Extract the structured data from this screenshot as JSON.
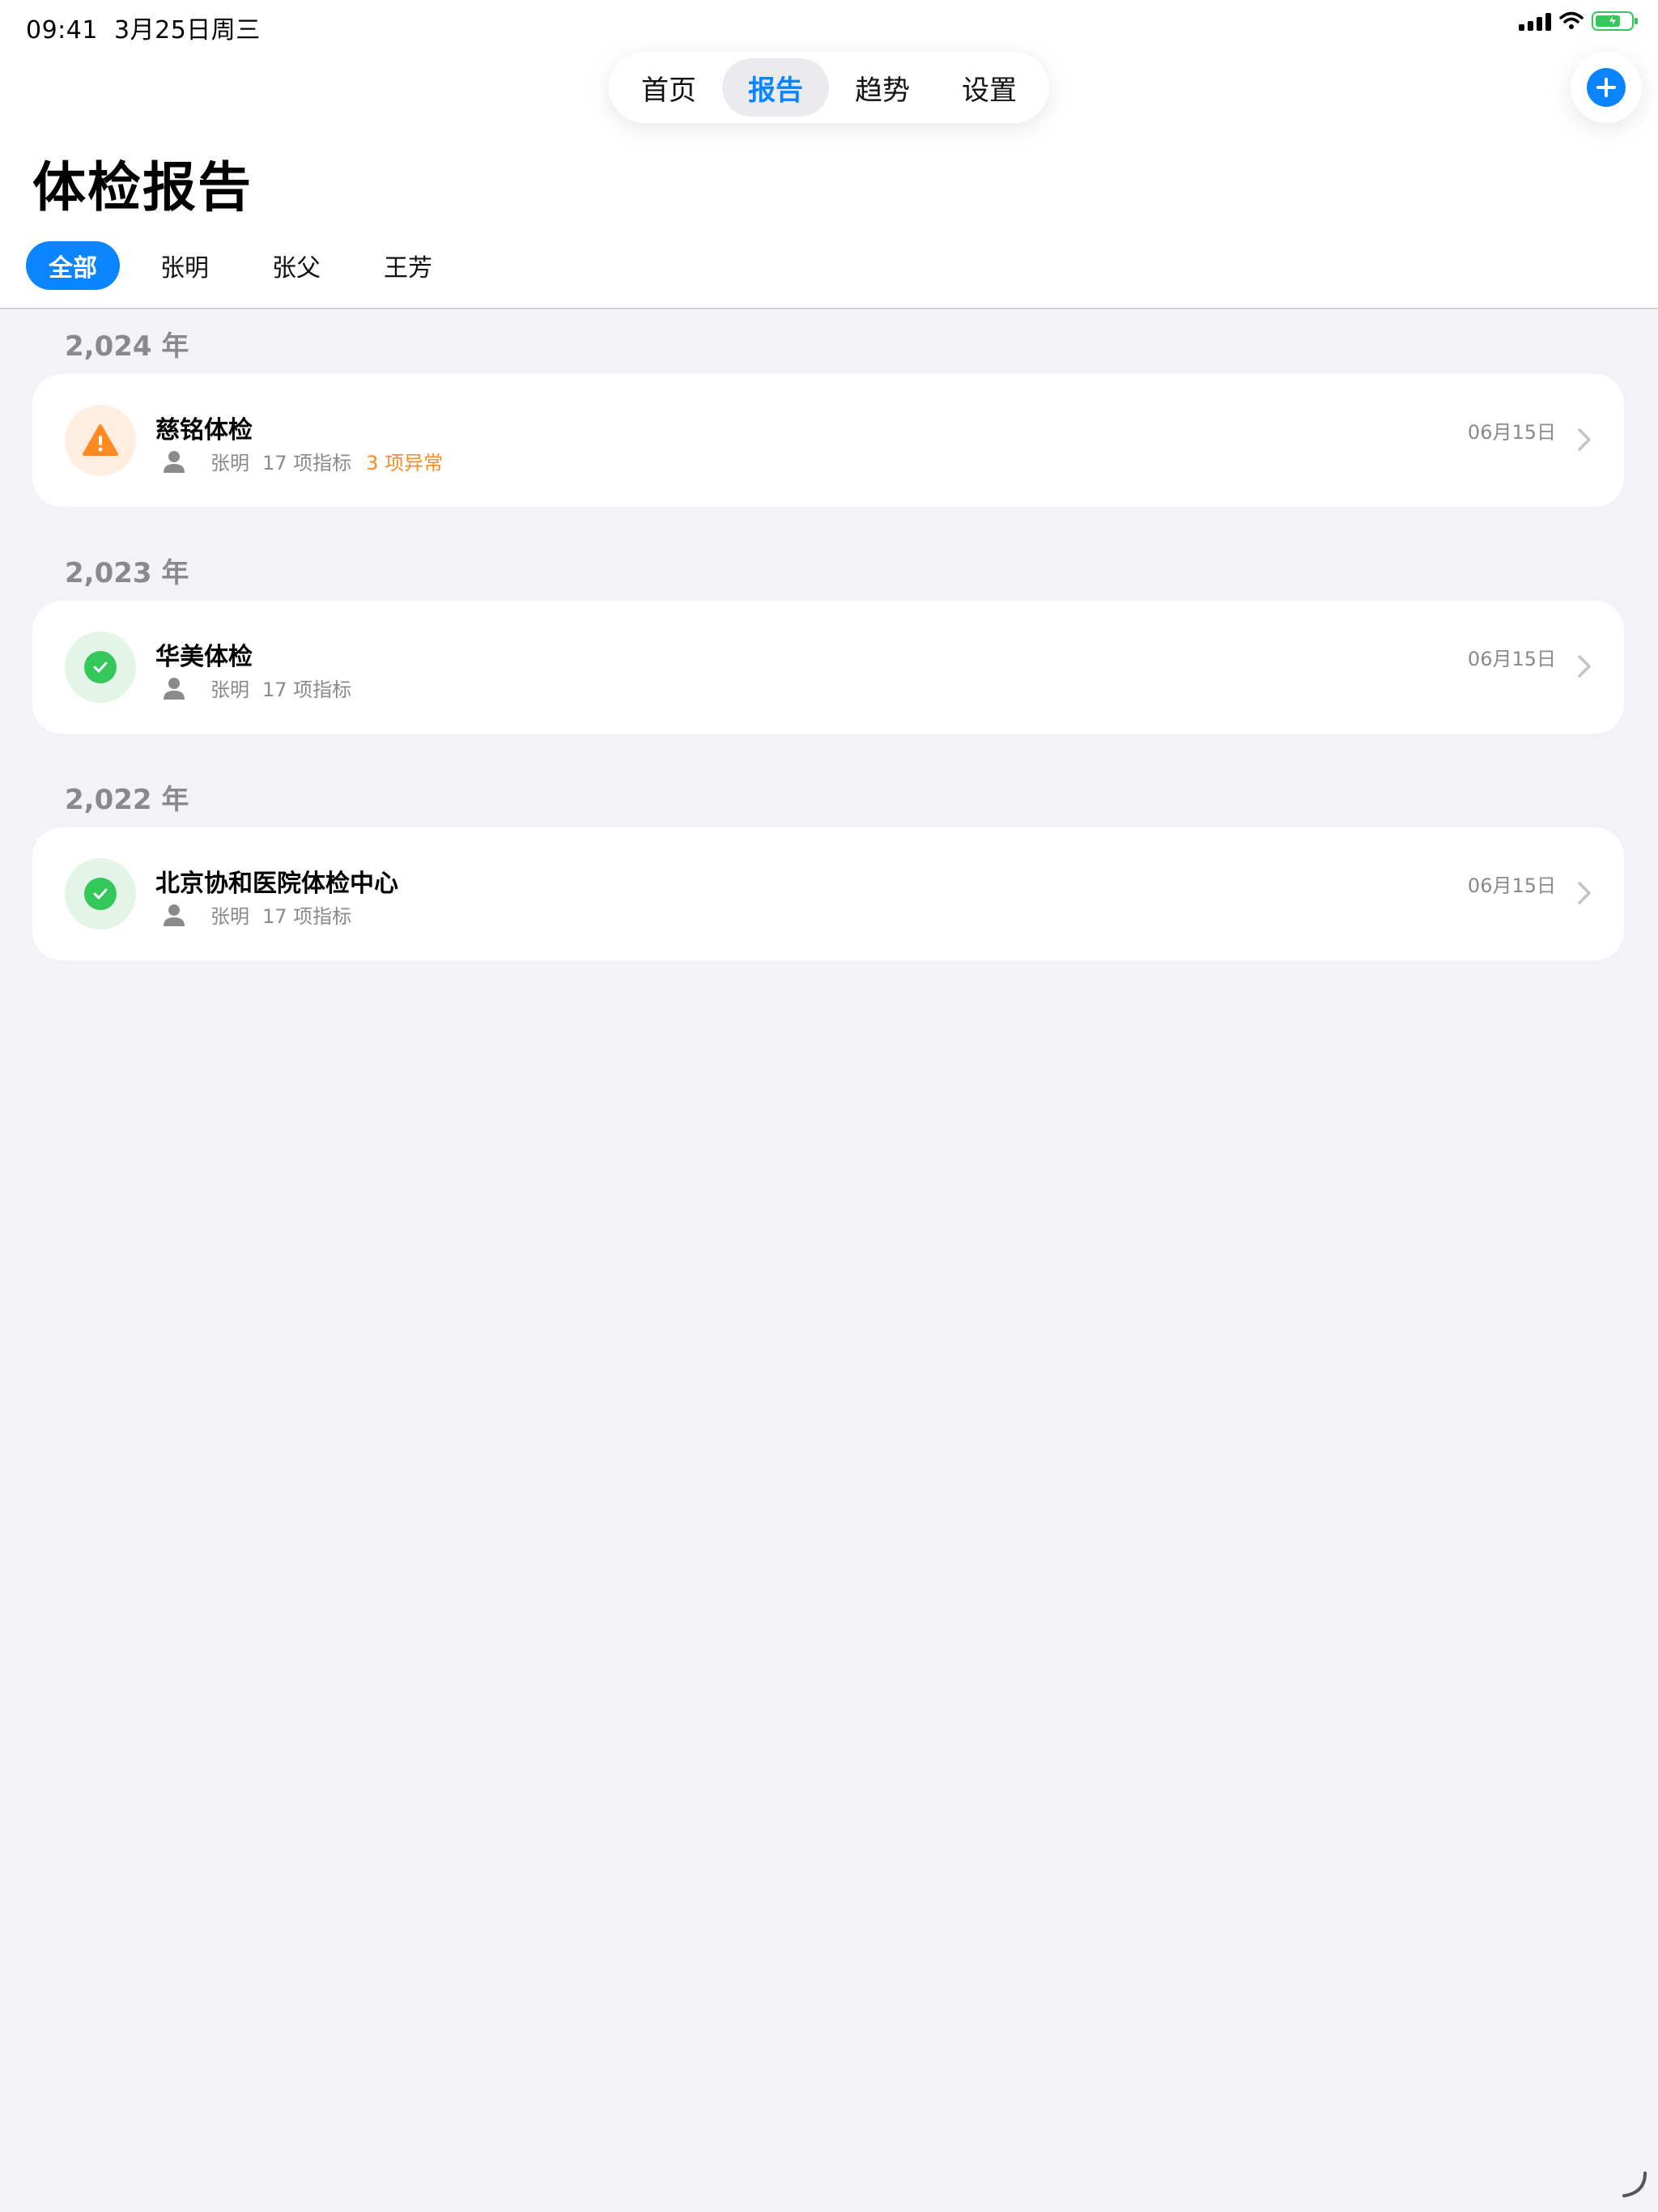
{
  "status_bar": {
    "time": "09:41",
    "date": "3月25日周三"
  },
  "nav": {
    "tabs": [
      {
        "label": "首页"
      },
      {
        "label": "报告"
      },
      {
        "label": "趋势"
      },
      {
        "label": "设置"
      }
    ],
    "active": "报告"
  },
  "page": {
    "title": "体检报告"
  },
  "filters": {
    "chips": [
      {
        "label": "全部"
      },
      {
        "label": "张明"
      },
      {
        "label": "张父"
      },
      {
        "label": "王芳"
      }
    ],
    "active": "全部"
  },
  "groups": [
    {
      "year": "2,024 年",
      "report": {
        "title": "慈铭体检",
        "person": "张明",
        "indicators": "17 项指标",
        "abnormal": "3 项异常",
        "date": "06月15日",
        "status": "warning"
      }
    },
    {
      "year": "2,023 年",
      "report": {
        "title": "华美体检",
        "person": "张明",
        "indicators": "17 项指标",
        "date": "06月15日",
        "status": "normal"
      }
    },
    {
      "year": "2,022 年",
      "report": {
        "title": "北京协和医院体检中心",
        "person": "张明",
        "indicators": "17 项指标",
        "date": "06月15日",
        "status": "normal"
      }
    }
  ],
  "colors": {
    "accent": "#0a84ff",
    "warning": "#ff8a1f",
    "success": "#34c759",
    "background": "#f2f2f7"
  },
  "icons": {
    "add": "plus-circle-icon",
    "warning": "warning-triangle-icon",
    "normal": "checkmark-circle-icon",
    "person": "person-icon",
    "chevron": "chevron-right-icon"
  }
}
